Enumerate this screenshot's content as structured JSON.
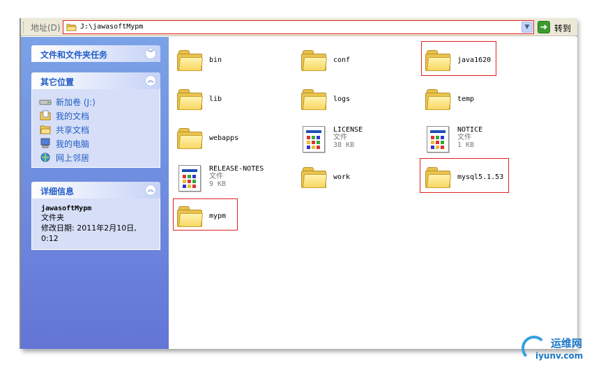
{
  "address_bar": {
    "label": "地址(D)",
    "path": "J:\\jawasoftMypm",
    "go_label": "转到"
  },
  "task_pane": {
    "tasks_title": "文件和文件夹任务",
    "places_title": "其它位置",
    "places": [
      {
        "label": "新加卷 (J:)",
        "icon": "drive-icon"
      },
      {
        "label": "我的文档",
        "icon": "my-documents-icon"
      },
      {
        "label": "共享文档",
        "icon": "shared-folder-icon"
      },
      {
        "label": "我的电脑",
        "icon": "my-computer-icon"
      },
      {
        "label": "网上邻居",
        "icon": "network-icon"
      }
    ],
    "details_title": "详细信息",
    "details": {
      "name": "jawasoftMypm",
      "type": "文件夹",
      "modified": "修改日期: 2011年2月10日,",
      "modified_time": "0:12"
    }
  },
  "files": [
    {
      "name": "bin",
      "kind": "folder"
    },
    {
      "name": "conf",
      "kind": "folder"
    },
    {
      "name": "java1620",
      "kind": "folder"
    },
    {
      "name": "lib",
      "kind": "folder"
    },
    {
      "name": "logs",
      "kind": "folder"
    },
    {
      "name": "temp",
      "kind": "folder"
    },
    {
      "name": "webapps",
      "kind": "folder"
    },
    {
      "name": "LICENSE",
      "kind": "file",
      "type": "文件",
      "size": "38 KB"
    },
    {
      "name": "NOTICE",
      "kind": "file",
      "type": "文件",
      "size": "1 KB"
    },
    {
      "name": "RELEASE-NOTES",
      "kind": "file",
      "type": "文件",
      "size": "9 KB"
    },
    {
      "name": "work",
      "kind": "folder"
    },
    {
      "name": "mysql5.1.53",
      "kind": "folder"
    },
    {
      "name": "mypm",
      "kind": "folder"
    }
  ],
  "watermark": {
    "cn": "运维网",
    "url": "iyunv.com"
  },
  "colors": {
    "task_pane_top": "#7ba2e7",
    "task_pane_bottom": "#6375d6",
    "link": "#215dc6",
    "highlight": "#e02020"
  }
}
